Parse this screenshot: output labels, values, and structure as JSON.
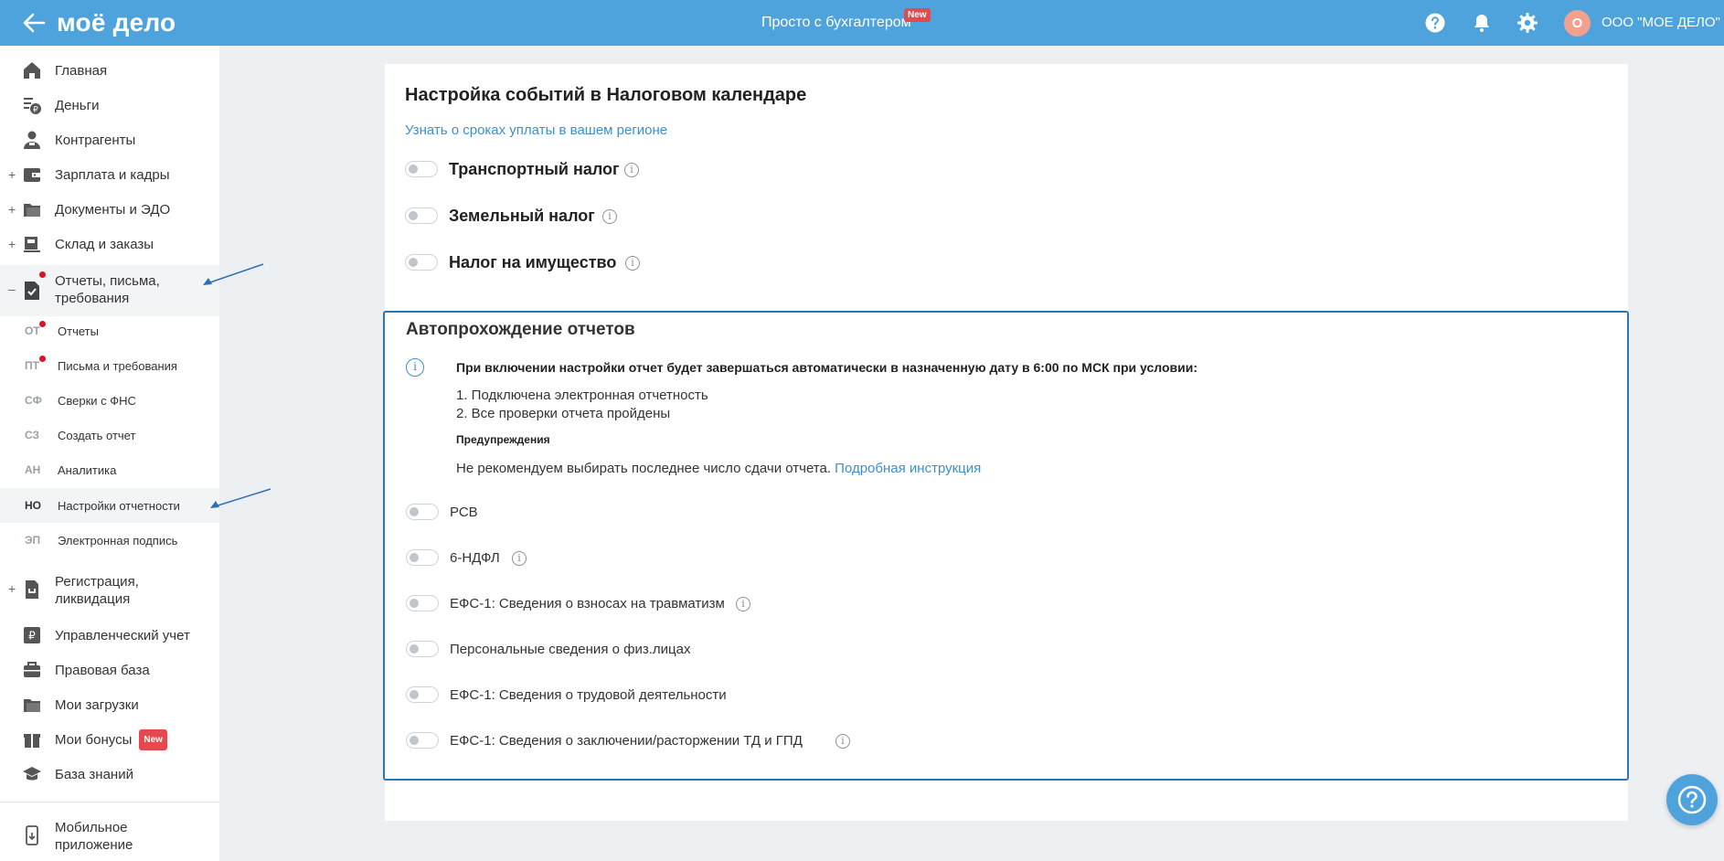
{
  "header": {
    "logo": "моё дело",
    "center_title": "Просто с бухгалтером",
    "new_badge": "New",
    "avatar_letter": "О",
    "org_name": "ООО \"МОЕ ДЕЛО\""
  },
  "sidebar": {
    "items": [
      {
        "label": "Главная"
      },
      {
        "label": "Деньги"
      },
      {
        "label": "Контрагенты"
      },
      {
        "label": "Зарплата и кадры"
      },
      {
        "label": "Документы и ЭДО"
      },
      {
        "label": "Склад и заказы"
      },
      {
        "label": "Отчеты, письма, требования"
      }
    ],
    "sub_items": [
      {
        "abbr": "ОТ",
        "label": "Отчеты"
      },
      {
        "abbr": "ПТ",
        "label": "Письма и требования"
      },
      {
        "abbr": "СФ",
        "label": "Сверки с ФНС"
      },
      {
        "abbr": "СЗ",
        "label": "Создать отчет"
      },
      {
        "abbr": "АН",
        "label": "Аналитика"
      },
      {
        "abbr": "НО",
        "label": "Настройки отчетности"
      },
      {
        "abbr": "ЭП",
        "label": "Электронная подпись"
      }
    ],
    "items_after": [
      {
        "label": "Регистрация, ликвидация"
      },
      {
        "label": "Управленческий учет"
      },
      {
        "label": "Правовая база"
      },
      {
        "label": "Мои загрузки"
      },
      {
        "label": "Мои бонусы"
      },
      {
        "label": "База знаний"
      }
    ],
    "bonus_badge": "New",
    "mobile_app": "Мобильное приложение"
  },
  "main": {
    "title": "Настройка событий в Налоговом календаре",
    "region_link": "Узнать о сроках уплаты в вашем регионе",
    "taxes": [
      {
        "label": "Транспортный налог"
      },
      {
        "label": "Земельный налог"
      },
      {
        "label": "Налог на имущество"
      }
    ],
    "auto": {
      "title": "Автопрохождение отчетов",
      "condition": "При включении настройки отчет будет завершаться автоматически в назначенную дату в 6:00 по МСК при условии:",
      "list_1": "1. Подключена электронная отчетность",
      "list_2": "2. Все проверки отчета пройдены",
      "warn_title": "Предупреждения",
      "warn_text": "Не рекомендуем выбирать последнее число сдачи отчета.",
      "warn_link": "Подробная инструкция",
      "reports": [
        {
          "label": "РСВ"
        },
        {
          "label": "6-НДФЛ"
        },
        {
          "label": "ЕФС-1: Сведения о взносах на травматизм"
        },
        {
          "label": "Персональные сведения о физ.лицах"
        },
        {
          "label": "ЕФС-1: Сведения о трудовой деятельности"
        },
        {
          "label": "ЕФС-1: Сведения о заключении/расторжении ТД и ГПД"
        }
      ]
    }
  },
  "colors": {
    "header_bg": "#4fa3dc",
    "link": "#3b8fd1",
    "frame": "#2e75b6",
    "badge": "#e5484d"
  }
}
